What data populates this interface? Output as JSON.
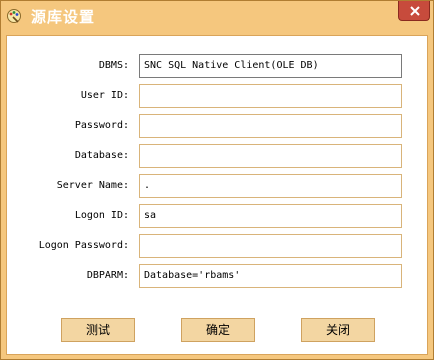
{
  "window": {
    "title": "源库设置",
    "app_icon": "pencil-palette-icon",
    "close_icon": "close-icon"
  },
  "colors": {
    "frame": "#f5c77e",
    "frame_border": "#b07d32",
    "close_button": "#c74b3c",
    "button_face": "#f3d6a2",
    "input_border": "#d9b47a"
  },
  "form": {
    "fields": [
      {
        "label": "DBMS:",
        "value": "SNC SQL Native Client(OLE DB)"
      },
      {
        "label": "User ID:",
        "value": ""
      },
      {
        "label": "Password:",
        "value": ""
      },
      {
        "label": "Database:",
        "value": ""
      },
      {
        "label": "Server Name:",
        "value": "."
      },
      {
        "label": "Logon ID:",
        "value": "sa"
      },
      {
        "label": "Logon Password:",
        "value": ""
      },
      {
        "label": "DBPARM:",
        "value": "Database='rbams'"
      }
    ]
  },
  "buttons": {
    "test": "测试",
    "ok": "确定",
    "close": "关闭"
  }
}
